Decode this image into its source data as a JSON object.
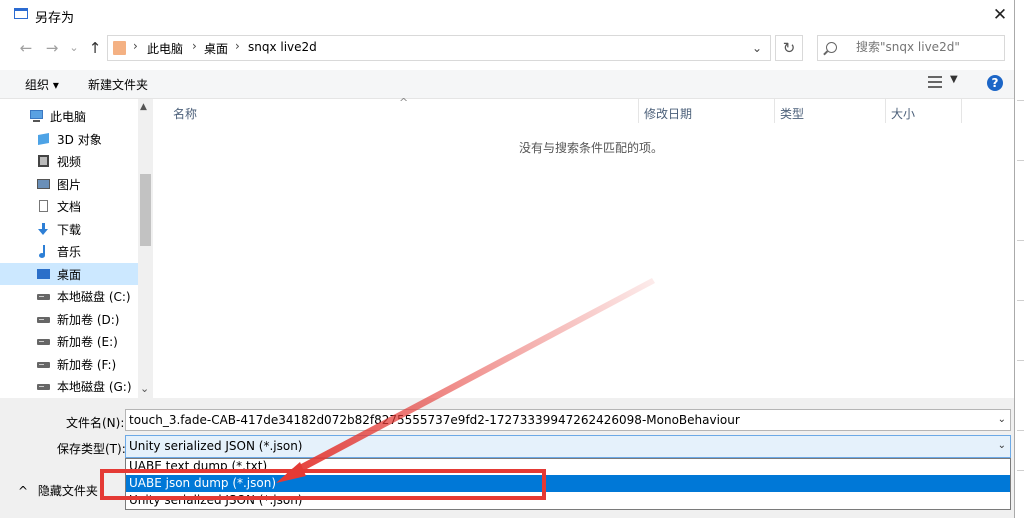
{
  "window": {
    "title": "另存为",
    "close_glyph": "✕"
  },
  "nav": {
    "back_glyph": "←",
    "forward_glyph": "→",
    "recent_glyph": "⌄",
    "up_glyph": "↑",
    "breadcrumb": [
      "此电脑",
      "桌面",
      "snqx live2d"
    ],
    "crumb_separator": "›",
    "dropdown_glyph": "⌄",
    "refresh_glyph": "↻",
    "search_placeholder": "搜索\"snqx live2d\""
  },
  "toolbar": {
    "organize_label": "组织 ▾",
    "new_folder_label": "新建文件夹",
    "view_dropdown_glyph": "▼",
    "help_glyph": "?"
  },
  "sidebar": {
    "items": [
      {
        "label": "此电脑",
        "icon": "computer-icon"
      },
      {
        "label": "3D 对象",
        "icon": "cube-icon"
      },
      {
        "label": "视频",
        "icon": "video-icon"
      },
      {
        "label": "图片",
        "icon": "picture-icon"
      },
      {
        "label": "文档",
        "icon": "document-icon"
      },
      {
        "label": "下载",
        "icon": "download-icon"
      },
      {
        "label": "音乐",
        "icon": "music-icon"
      },
      {
        "label": "桌面",
        "icon": "desktop-icon",
        "selected": true
      },
      {
        "label": "本地磁盘 (C:)",
        "icon": "drive-icon"
      },
      {
        "label": "新加卷 (D:)",
        "icon": "drive-icon"
      },
      {
        "label": "新加卷 (E:)",
        "icon": "drive-icon"
      },
      {
        "label": "新加卷 (F:)",
        "icon": "drive-icon"
      },
      {
        "label": "本地磁盘 (G:)",
        "icon": "drive-icon"
      }
    ],
    "scroll_up_glyph": "▲",
    "scroll_down_glyph": "⌄"
  },
  "filelist": {
    "sort_glyph": "^",
    "columns": [
      "名称",
      "修改日期",
      "类型",
      "大小"
    ],
    "empty_message": "没有与搜索条件匹配的项。"
  },
  "form": {
    "filename_label": "文件名(N):",
    "filename_value": "touch_3.fade-CAB-417de34182d072b82f8275555737e9fd2-17273339947262426098-MonoBehaviour",
    "filetype_label": "保存类型(T):",
    "filetype_value": "Unity serialized JSON (*.json)",
    "dropdown_glyph": "⌄",
    "options": [
      "UABE text dump (*.txt)",
      "UABE json dump (*.json)",
      "Unity serialized JSON (*.json)"
    ],
    "highlighted_option": 1,
    "hide_folders_label": "隐藏文件夹",
    "hide_folders_glyph": "^"
  },
  "colors": {
    "highlight": "#0078d7",
    "selection": "#cce8ff",
    "annotation_red": "#e43a35",
    "accent_blue": "#1c66c7"
  }
}
